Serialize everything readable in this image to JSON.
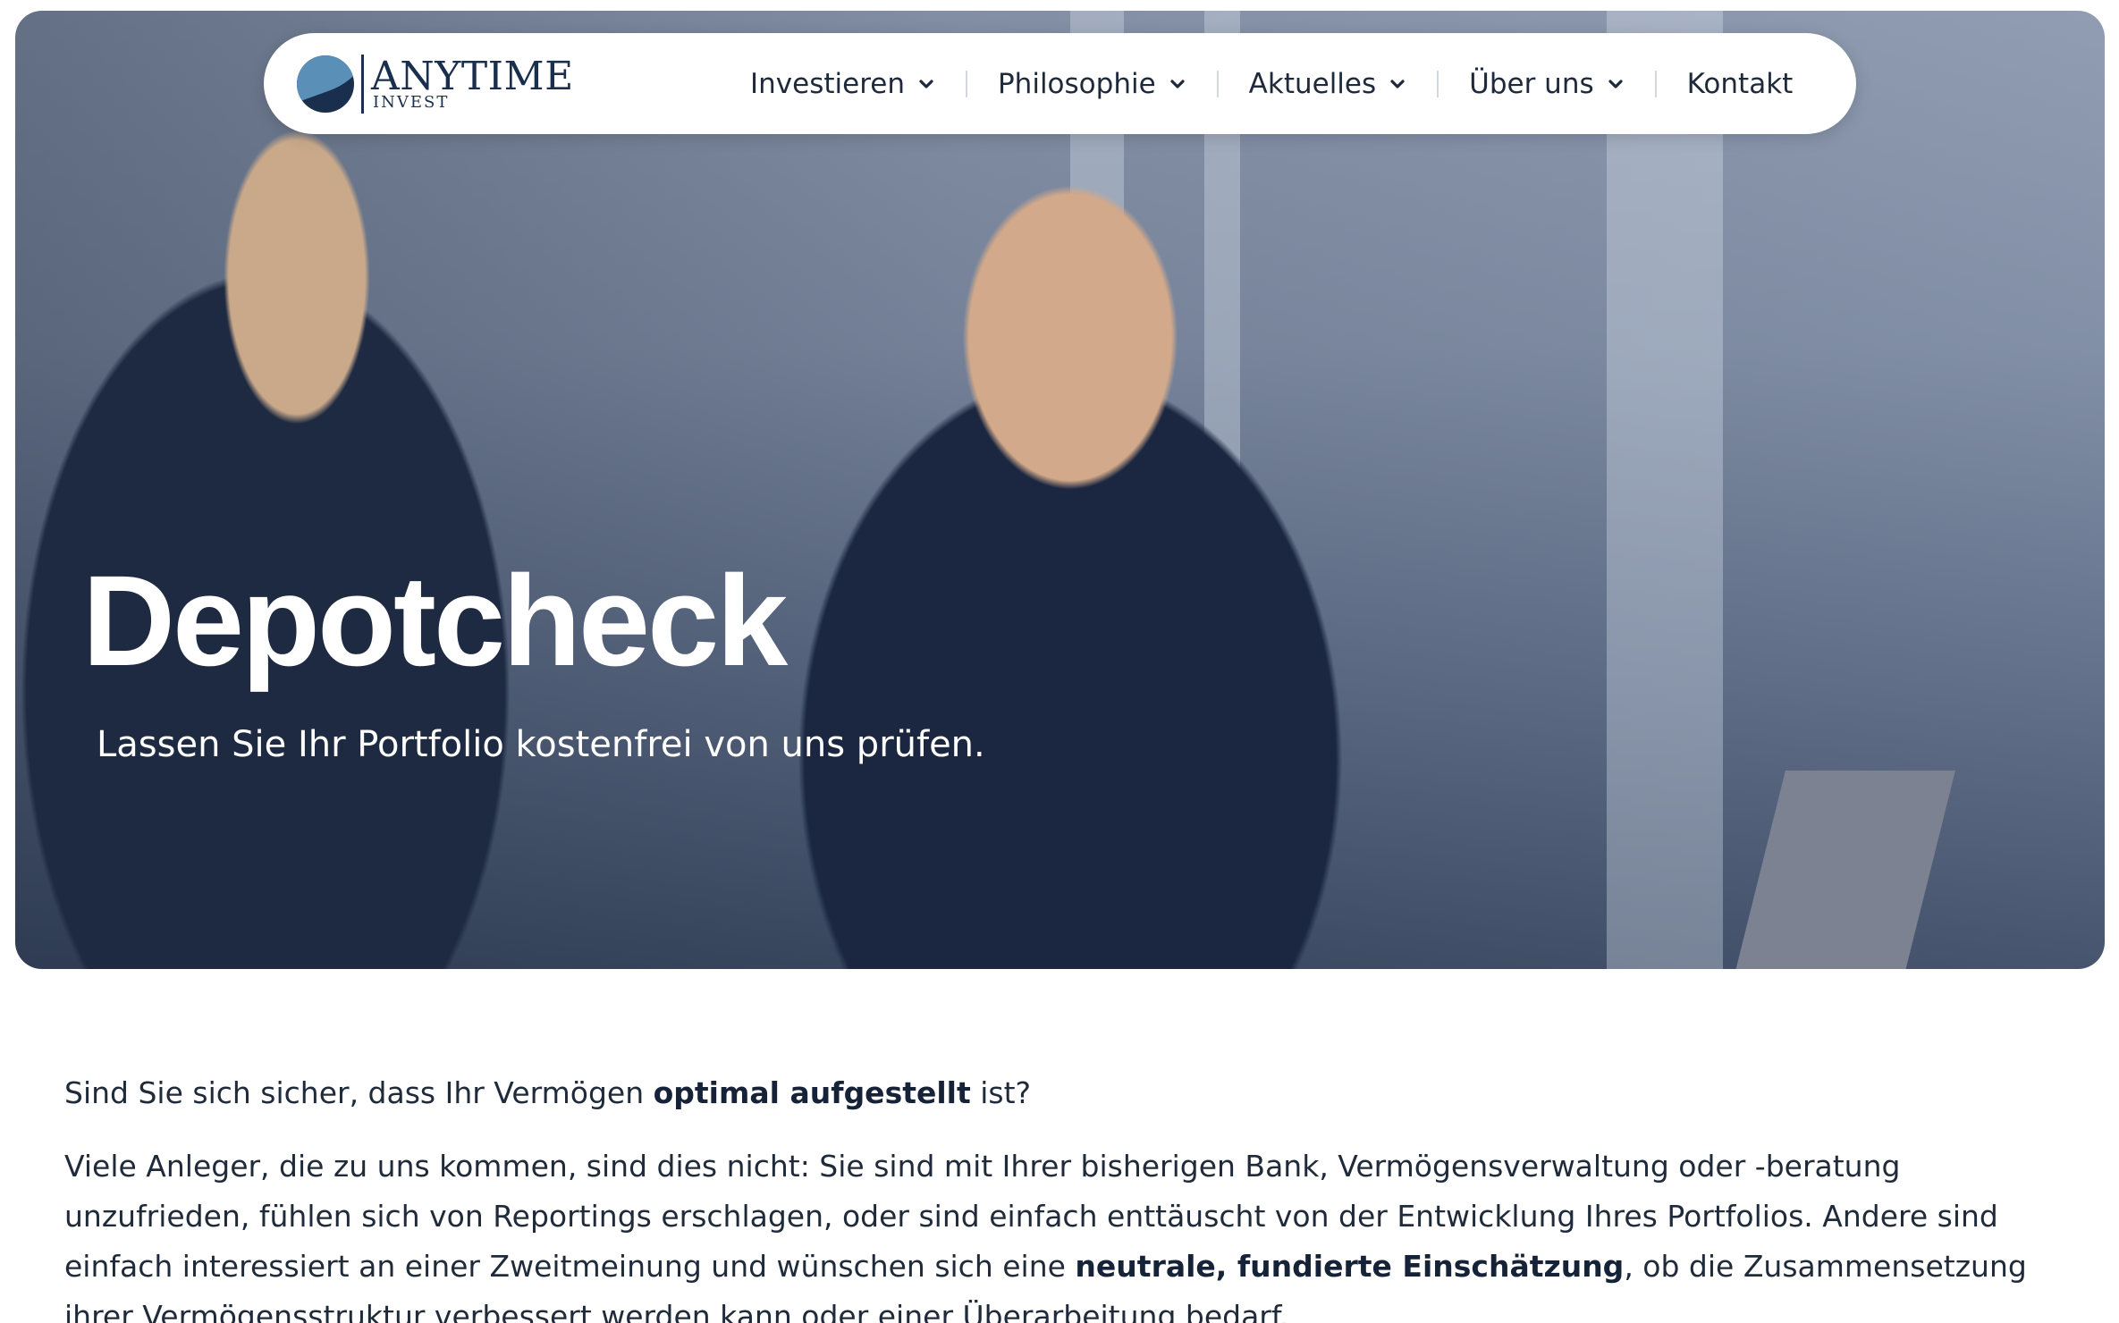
{
  "header": {
    "logo": {
      "title": "ANYTIME",
      "subtitle": "INVEST"
    },
    "nav": [
      {
        "label": "Investieren",
        "has_dropdown": true
      },
      {
        "label": "Philosophie",
        "has_dropdown": true
      },
      {
        "label": "Aktuelles",
        "has_dropdown": true
      },
      {
        "label": "Über uns",
        "has_dropdown": true
      },
      {
        "label": "Kontakt",
        "has_dropdown": false
      }
    ]
  },
  "hero": {
    "title": "Depotcheck",
    "subtitle": "Lassen Sie Ihr Portfolio kostenfrei von uns prüfen."
  },
  "content": {
    "p1": {
      "before": "Sind Sie sich sicher, dass Ihr Vermögen ",
      "bold": "optimal aufgestellt",
      "after": " ist?"
    },
    "p2": {
      "before": "Viele Anleger, die zu uns kommen, sind dies nicht: Sie sind mit Ihrer bisherigen Bank, Vermögensverwaltung oder -beratung unzufrieden, fühlen sich von Reportings erschlagen, oder sind einfach enttäuscht von der Entwicklung Ihres Portfolios. Andere sind einfach interessiert an einer Zweitmeinung und wünschen sich eine ",
      "bold": "neutrale, fundierte Einschätzung",
      "after": ", ob die Zusammensetzung ihrer Vermögensstruktur verbessert werden kann oder einer Überarbeitung bedarf."
    }
  },
  "colors": {
    "brand_navy": "#1a2f4d",
    "brand_blue": "#5a8fb8",
    "text": "#1f2a3a"
  },
  "icons": {
    "dropdown": "chevron-down-icon"
  }
}
